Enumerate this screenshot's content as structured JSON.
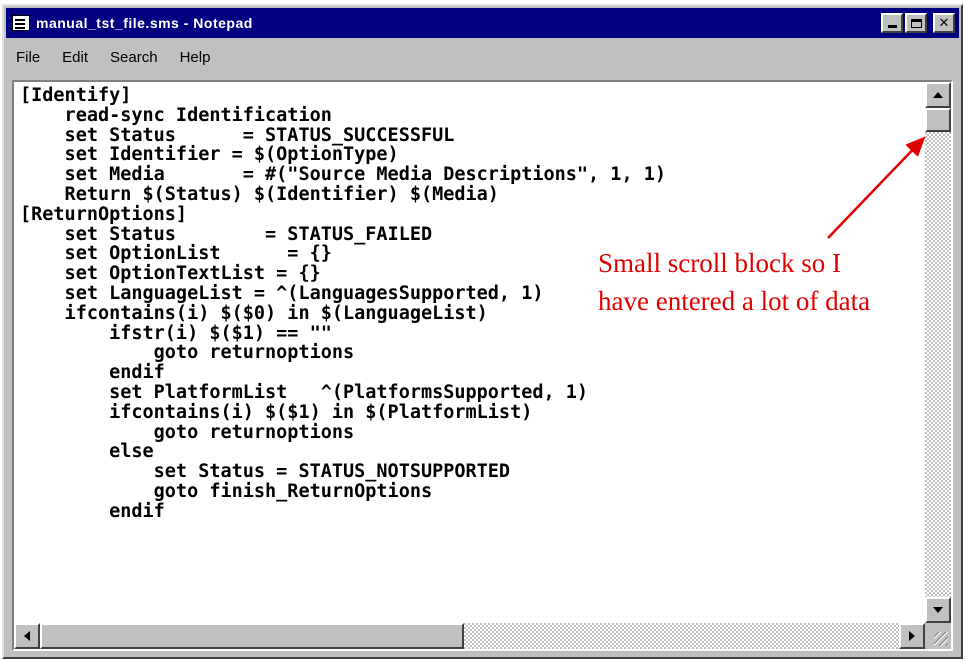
{
  "window": {
    "title": "manual_tst_file.sms - Notepad",
    "title_buttons": {
      "minimize_icon": "minimize-icon",
      "maximize_icon": "maximize-icon",
      "close_label": "✕"
    }
  },
  "menu": [
    {
      "label": "File"
    },
    {
      "label": "Edit"
    },
    {
      "label": "Search"
    },
    {
      "label": "Help"
    }
  ],
  "editor": {
    "lines": [
      "[Identify]",
      "    read-sync Identification",
      "    set Status      = STATUS_SUCCESSFUL",
      "    set Identifier = $(OptionType)",
      "    set Media       = #(\"Source Media Descriptions\", 1, 1)",
      "    Return $(Status) $(Identifier) $(Media)",
      "[ReturnOptions]",
      "    set Status        = STATUS_FAILED",
      "    set OptionList      = {}",
      "    set OptionTextList = {}",
      "    set LanguageList = ^(LanguagesSupported, 1)",
      "    ifcontains(i) $($0) in $(LanguageList)",
      "        ifstr(i) $($1) == \"\"",
      "            goto returnoptions",
      "        endif",
      "        set PlatformList   ^(PlatformsSupported, 1)",
      "        ifcontains(i) $($1) in $(PlatformList)",
      "            goto returnoptions",
      "        else",
      "            set Status = STATUS_NOTSUPPORTED",
      "            goto finish_ReturnOptions",
      "        endif"
    ]
  },
  "annotation": {
    "line1": "Small scroll block  so I",
    "line2": "have entered a lot of data",
    "color": "#e00000"
  },
  "colors": {
    "titlebar": "#000080",
    "chrome": "#c0c0c0"
  }
}
